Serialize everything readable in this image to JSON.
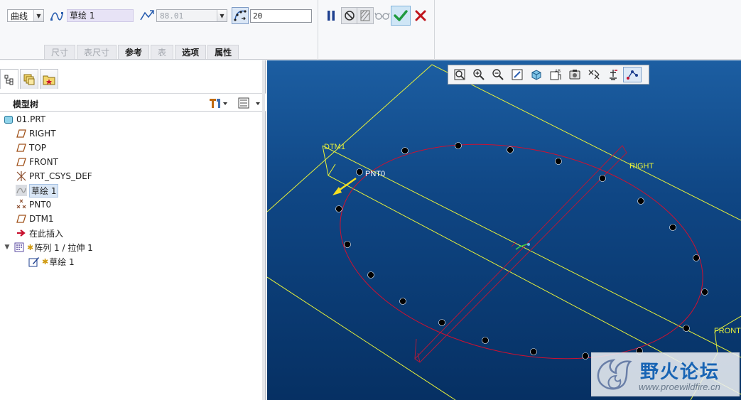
{
  "dashboard": {
    "curve_type": "曲线",
    "sketch_ref": "草绘 1",
    "angle_value": "88.01",
    "count_value": "20",
    "tabs": [
      {
        "label": "尺寸",
        "enabled": false
      },
      {
        "label": "表尺寸",
        "enabled": false
      },
      {
        "label": "参考",
        "enabled": true
      },
      {
        "label": "表",
        "enabled": false
      },
      {
        "label": "选项",
        "enabled": true
      },
      {
        "label": "属性",
        "enabled": true
      }
    ],
    "actions": {
      "pause_icon": "pause-icon",
      "no_preview_icon": "no-preview-icon",
      "feature_preview_icon": "feature-preview-icon",
      "verify_icon": "glasses-icon",
      "ok_icon": "checkmark-icon",
      "cancel_icon": "x-icon",
      "ok_color": "#1f9a3e",
      "cancel_color": "#c0141c"
    }
  },
  "left_panel": {
    "nav_tabs": [
      "model-tree-tab",
      "layers-tab",
      "favorites-tab"
    ],
    "tree_title": "模型树",
    "tree_items": [
      {
        "label": "01.PRT",
        "icon": "part-icon",
        "indent": 0,
        "selected": false
      },
      {
        "label": "RIGHT",
        "icon": "datum-plane-icon",
        "indent": 1,
        "selected": false
      },
      {
        "label": "TOP",
        "icon": "datum-plane-icon",
        "indent": 1,
        "selected": false
      },
      {
        "label": "FRONT",
        "icon": "datum-plane-icon",
        "indent": 1,
        "selected": false
      },
      {
        "label": "PRT_CSYS_DEF",
        "icon": "csys-icon",
        "indent": 1,
        "selected": false
      },
      {
        "label": "草绘 1",
        "icon": "sketch-icon",
        "indent": 1,
        "selected": true
      },
      {
        "label": "PNT0",
        "icon": "datum-point-icon",
        "indent": 1,
        "selected": false
      },
      {
        "label": "DTM1",
        "icon": "datum-plane-icon",
        "indent": 1,
        "selected": false
      },
      {
        "label": "在此插入",
        "icon": "insert-here-arrow-icon",
        "indent": 1,
        "selected": false
      },
      {
        "label": "阵列 1 / 拉伸 1",
        "icon": "pattern-icon",
        "indent": 0,
        "selected": false
      },
      {
        "label": "草绘 1",
        "icon": "sketch-edit-icon",
        "indent": 2,
        "selected": false
      }
    ]
  },
  "graphics": {
    "labels": {
      "dtm1": "DTM1",
      "pnt0": "PNT0",
      "right": "RIGHT",
      "front": "FRONT"
    },
    "toolbar_icons": [
      "refit-icon",
      "zoom-in-icon",
      "zoom-out-icon",
      "repaint-icon",
      "display-style-icon",
      "saved-views-icon",
      "datum-display-icon",
      "spin-center-icon",
      "annotation-display-icon",
      "sketch-view-icon",
      "point-display-icon"
    ],
    "colors": {
      "datum": "#e6f03a",
      "sketch": "#d01030",
      "point": "#000000"
    },
    "watermark": {
      "text": "野火论坛",
      "url": "www.proewildfire.cn"
    }
  }
}
